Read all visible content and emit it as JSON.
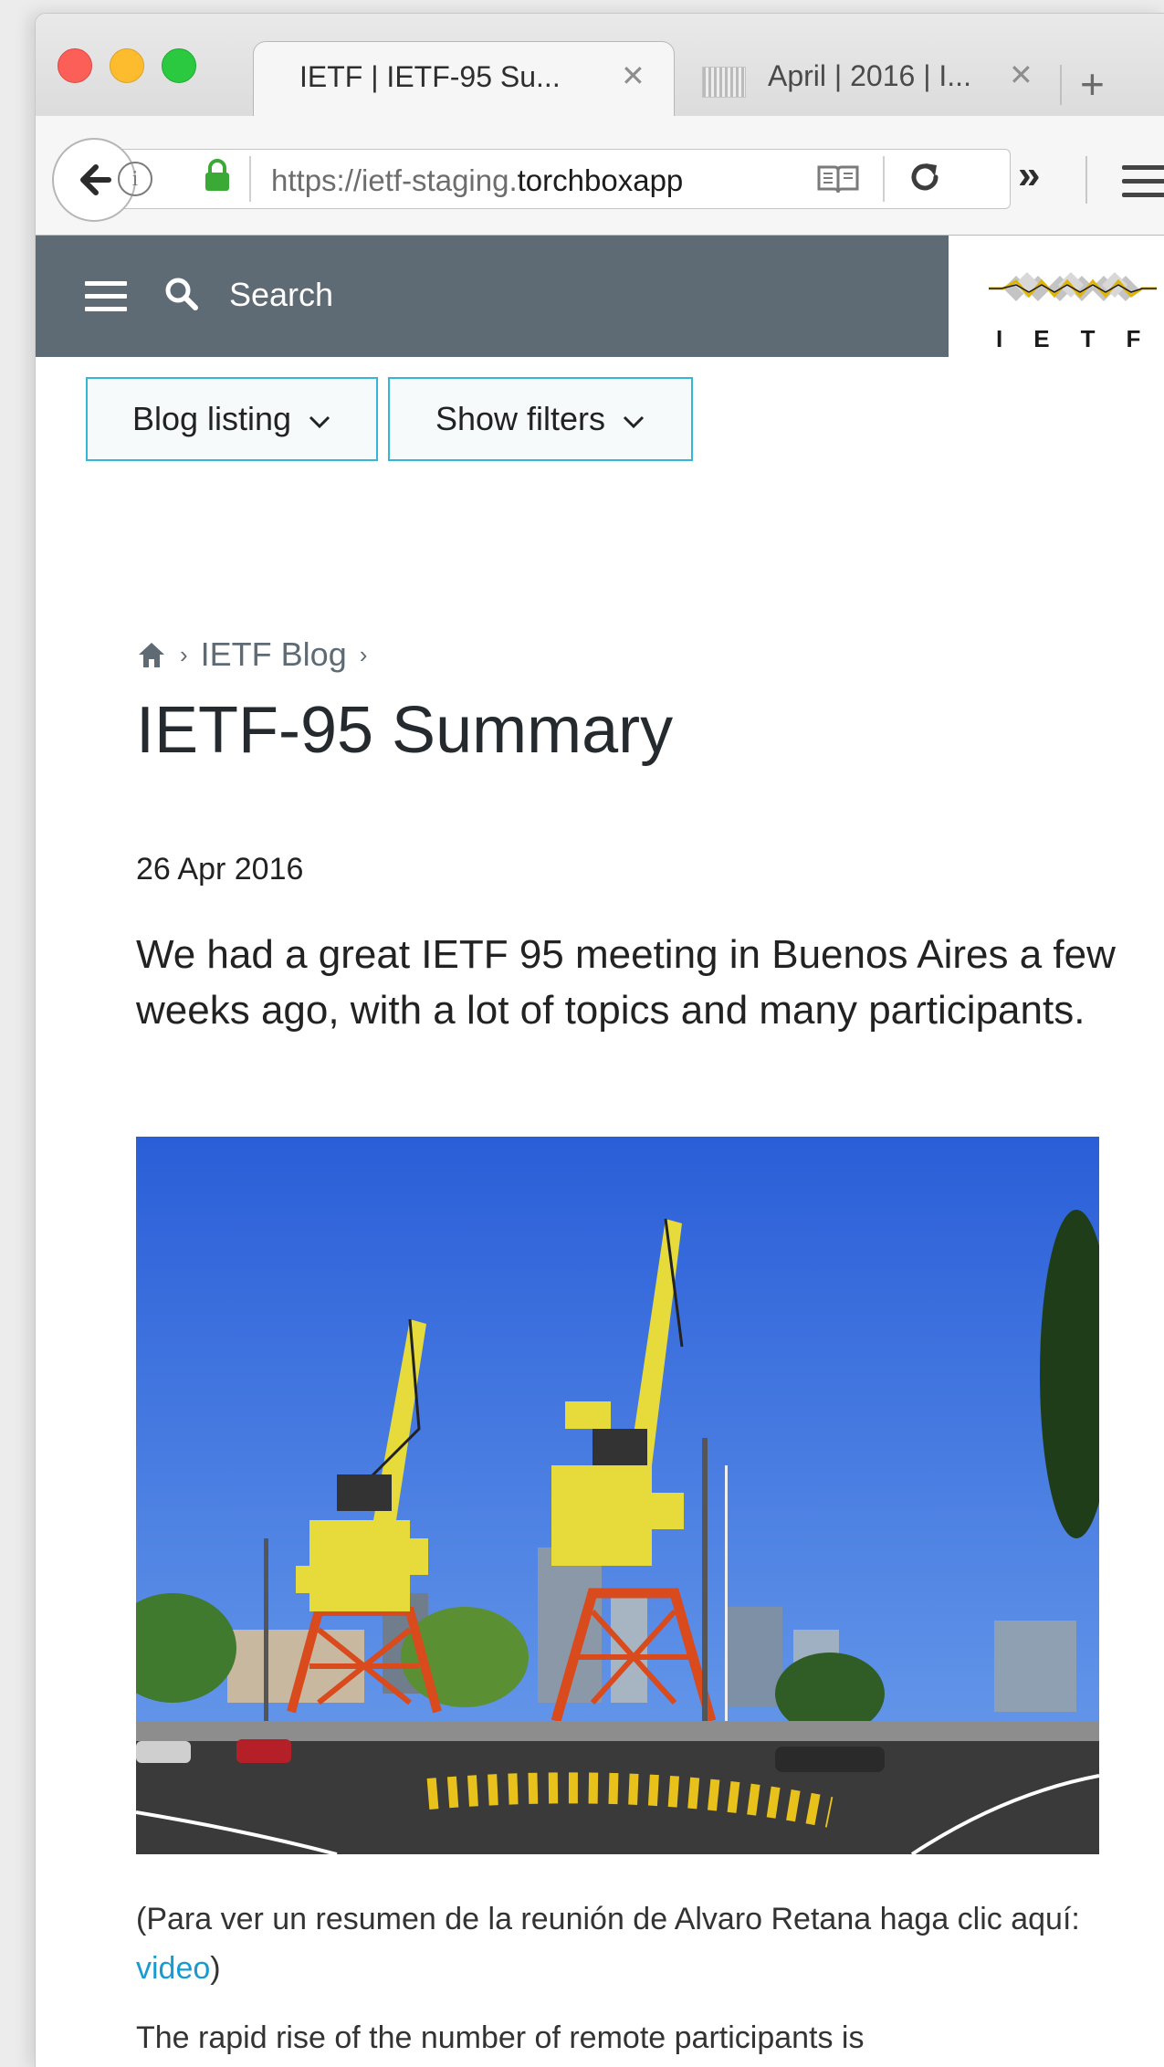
{
  "browser": {
    "tabs": [
      {
        "label": "IETF | IETF-95 Su...",
        "close": "✕",
        "active": true
      },
      {
        "label": "April | 2016 | I...",
        "close": "✕",
        "active": false
      }
    ],
    "new_tab": "+",
    "url_prefix": "https://ietf-staging.",
    "url_host": "torchboxapp",
    "info_glyph": "i",
    "overflow_glyph": "»"
  },
  "site": {
    "search_label": "Search",
    "logo_text": "IETF"
  },
  "controls": {
    "blog_listing": "Blog listing",
    "show_filters": "Show filters"
  },
  "article": {
    "breadcrumb": [
      "IETF Blog"
    ],
    "title": "IETF-95 Summary",
    "date": "26 Apr 2016",
    "intro": "We had a great IETF 95 meeting in Buenos Aires a few weeks ago, with a lot of topics and many participants.",
    "caption_before": "(Para ver un resumen de la reunión de Alvaro Retana haga clic aquí: ",
    "caption_link": "video",
    "caption_after": ")",
    "body_start": "The rapid rise of the number of remote participants is"
  },
  "colors": {
    "nav_bg": "#5f6b74",
    "button_border": "#36b6d6",
    "link": "#1a9bd0",
    "lock_green": "#3aa935"
  }
}
